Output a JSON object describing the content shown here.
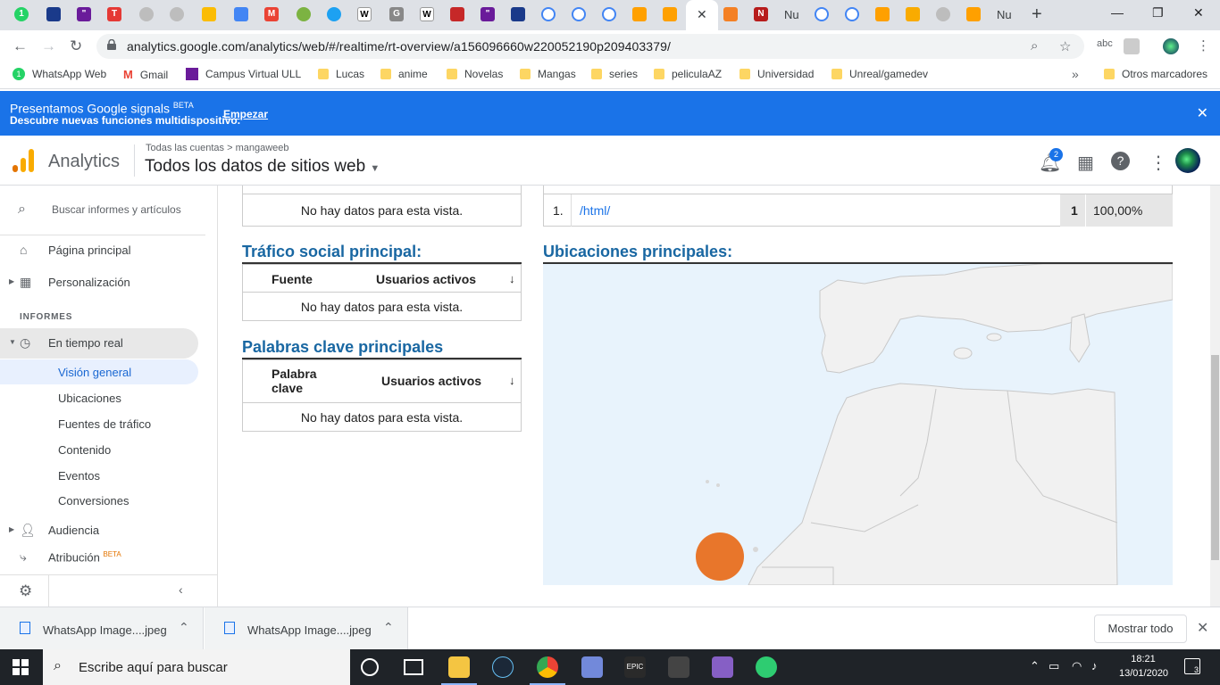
{
  "browser": {
    "partial_tab_labels": [
      "Nu",
      "Nu"
    ],
    "url": "analytics.google.com/analytics/web/#/realtime/rt-overview/a156096660w220052190p209403379/",
    "bookmarks": [
      {
        "label": "WhatsApp Web",
        "icon": "whatsapp-icon"
      },
      {
        "label": "Gmail",
        "icon": "gmail-icon"
      },
      {
        "label": "Campus Virtual ULL",
        "icon": "campus-icon"
      },
      {
        "label": "Lucas",
        "icon": "folder-icon"
      },
      {
        "label": "anime",
        "icon": "folder-icon"
      },
      {
        "label": "Novelas",
        "icon": "folder-icon"
      },
      {
        "label": "Mangas",
        "icon": "folder-icon"
      },
      {
        "label": "series",
        "icon": "folder-icon"
      },
      {
        "label": "peliculaAZ",
        "icon": "folder-icon"
      },
      {
        "label": "Universidad",
        "icon": "folder-icon"
      },
      {
        "label": "Unreal/gamedev",
        "icon": "folder-icon"
      }
    ],
    "other_bookmarks": "Otros marcadores"
  },
  "banner": {
    "title": "Presentamos Google signals",
    "beta": "BETA",
    "subtitle": "Descubre nuevas funciones multidispositivo.",
    "cta": "Empezar"
  },
  "ga": {
    "product": "Analytics",
    "breadcrumb_root": "Todas las cuentas",
    "breadcrumb_account": "mangaweeb",
    "view_name": "Todos los datos de sitios web",
    "notifications_count": "2"
  },
  "sidebar": {
    "search_placeholder": "Buscar informes y artículos",
    "home": "Página principal",
    "customization": "Personalización",
    "reports_heading": "INFORMES",
    "realtime": "En tiempo real",
    "realtime_items": [
      "Visión general",
      "Ubicaciones",
      "Fuentes de tráfico",
      "Contenido",
      "Eventos",
      "Conversiones"
    ],
    "audience": "Audiencia",
    "attribution": "Atribución",
    "attribution_badge": "BETA"
  },
  "main": {
    "top_left_nodata": "No hay datos para esta vista.",
    "top_right_row": {
      "index": "1.",
      "page": "/html/",
      "users": "1",
      "percent": "100,00%"
    },
    "social": {
      "title": "Tráfico social principal:",
      "col_source": "Fuente",
      "col_users": "Usuarios activos",
      "nodata": "No hay datos para esta vista."
    },
    "keywords": {
      "title": "Palabras clave principales",
      "col_keyword_1": "Palabra",
      "col_keyword_2": "clave",
      "col_users": "Usuarios activos",
      "nodata": "No hay datos para esta vista."
    },
    "locations": {
      "title": "Ubicaciones principales:",
      "marker_color": "#e8762b"
    }
  },
  "downloads": {
    "items": [
      "WhatsApp Image....jpeg",
      "WhatsApp Image....jpeg"
    ],
    "show_all": "Mostrar todo"
  },
  "taskbar": {
    "search_placeholder": "Escribe aquí para buscar",
    "time": "18:21",
    "date": "13/01/2020",
    "notifications": "3"
  }
}
